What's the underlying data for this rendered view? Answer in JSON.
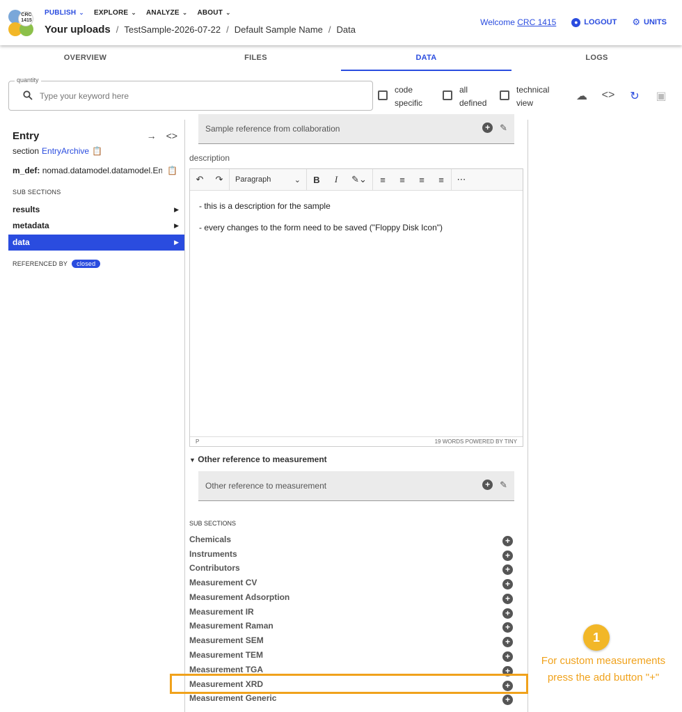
{
  "logo": {
    "text": "CRC\n1415"
  },
  "menu": [
    {
      "label": "PUBLISH"
    },
    {
      "label": "EXPLORE"
    },
    {
      "label": "ANALYZE"
    },
    {
      "label": "ABOUT"
    }
  ],
  "breadcrumb": {
    "first": "Your uploads",
    "items": [
      "TestSample-2026-07-22",
      "Default Sample Name",
      "Data"
    ]
  },
  "user": {
    "welcome": "Welcome",
    "name": "CRC 1415",
    "logout": "LOGOUT",
    "units": "UNITS"
  },
  "tabs": [
    "OVERVIEW",
    "FILES",
    "DATA",
    "LOGS"
  ],
  "search": {
    "legend": "quantity",
    "placeholder": "Type your keyword here"
  },
  "filters": [
    {
      "label": "code specific"
    },
    {
      "label": "all defined"
    },
    {
      "label": "technical view"
    }
  ],
  "entry": {
    "title": "Entry",
    "section_label": "section",
    "section_value": "EntryArchive",
    "mdef_label": "m_def:",
    "mdef_value": "nomad.datamodel.datamodel.EntryArchive",
    "sub_sections_label": "SUB SECTIONS",
    "nav": [
      "results",
      "metadata",
      "data"
    ],
    "referenced_by": "REFERENCED BY",
    "referenced_badge": "closed"
  },
  "form": {
    "sample_ref_placeholder": "Sample reference from collaboration",
    "description_label": "description",
    "editor": {
      "block_format": "Paragraph",
      "lines": [
        "- this is a description for the sample",
        "- every changes to the form need to be saved (\"Floppy Disk Icon\")"
      ],
      "status_left": "P",
      "status_right": "19 WORDS  POWERED BY TINY"
    },
    "other_ref_title": "Other reference to measurement",
    "other_ref_placeholder": "Other reference to measurement",
    "sub_sections_label": "SUB SECTIONS",
    "sub_sections": [
      "Chemicals",
      "Instruments",
      "Contributors",
      "Measurement CV",
      "Measurement Adsorption",
      "Measurement IR",
      "Measurement Raman",
      "Measurement SEM",
      "Measurement TEM",
      "Measurement TGA",
      "Measurement XRD",
      "Measurement Generic"
    ]
  },
  "annotation": {
    "number": "1",
    "text": "For custom measurements press the add button \"+\""
  },
  "colors": {
    "accent": "#2a4cdf",
    "highlight": "#f0a21c"
  }
}
